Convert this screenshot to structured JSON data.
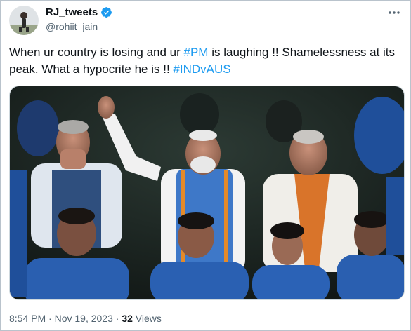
{
  "author": {
    "display_name": "RJ_tweets",
    "handle": "@rohiit_jain",
    "verified": true,
    "badge_color": "#1d9bf0"
  },
  "tweet": {
    "text_1": "When ur country is losing and ur ",
    "hashtag_1": "#PM",
    "text_2": " is laughing !! Shamelessness at its peak. What a hypocrite he is !! ",
    "hashtag_2": "#INDvAUS"
  },
  "meta": {
    "time": "8:54 PM",
    "sep1": " · ",
    "date": "Nov 19, 2023",
    "sep2": " · ",
    "views_count": "32",
    "views_label": " Views"
  },
  "icons": {
    "more": "more-horizontal-icon",
    "verified": "verified-badge-icon"
  },
  "colors": {
    "hashtag": "#1d9bf0",
    "secondary_text": "#536471"
  }
}
